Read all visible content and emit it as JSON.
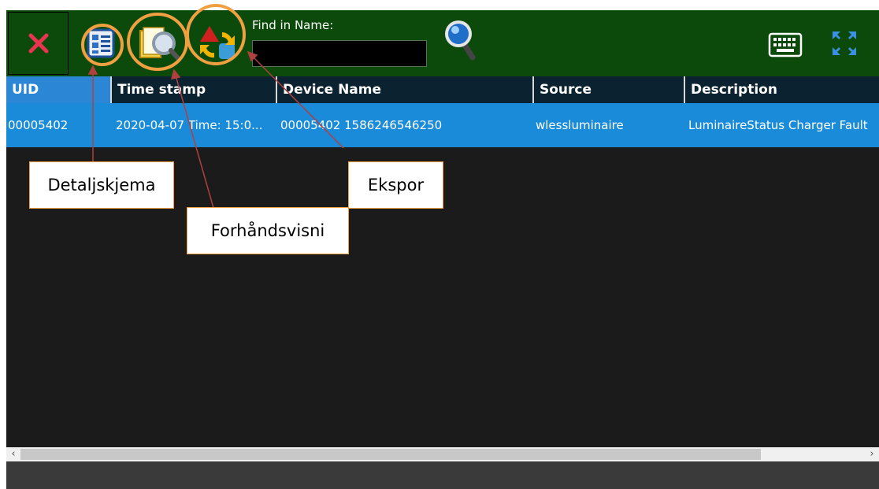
{
  "toolbar": {
    "close_icon": "close-x-icon",
    "detail_icon": "detail-form-icon",
    "preview_icon": "print-preview-icon",
    "export_icon": "export-icon",
    "find_label": "Find in Name:",
    "find_value": "",
    "search_icon": "magnifier-search-icon",
    "keyboard_icon": "keyboard-icon",
    "fullscreen_icon": "expand-arrows-icon"
  },
  "table": {
    "columns": [
      "UID",
      "Time stamp",
      "Device Name",
      "Source",
      "Description"
    ],
    "rows": [
      [
        "00005402",
        "2020-04-07 Time: 15:0...",
        "00005402 1586246546250",
        "wlessluminaire",
        "LuminaireStatus Charger Fault"
      ]
    ]
  },
  "callouts": {
    "detail": "Detaljskjema",
    "preview": "Forhåndsvisni",
    "export": "Ekspor"
  },
  "colors": {
    "toolbar_bg": "#0c4a0c",
    "selected_row": "#1a8bd9",
    "uid_header": "#2c86d6",
    "header_bg": "#0b2330",
    "highlight_ring": "#f0a040",
    "arrow": "#b04040"
  }
}
